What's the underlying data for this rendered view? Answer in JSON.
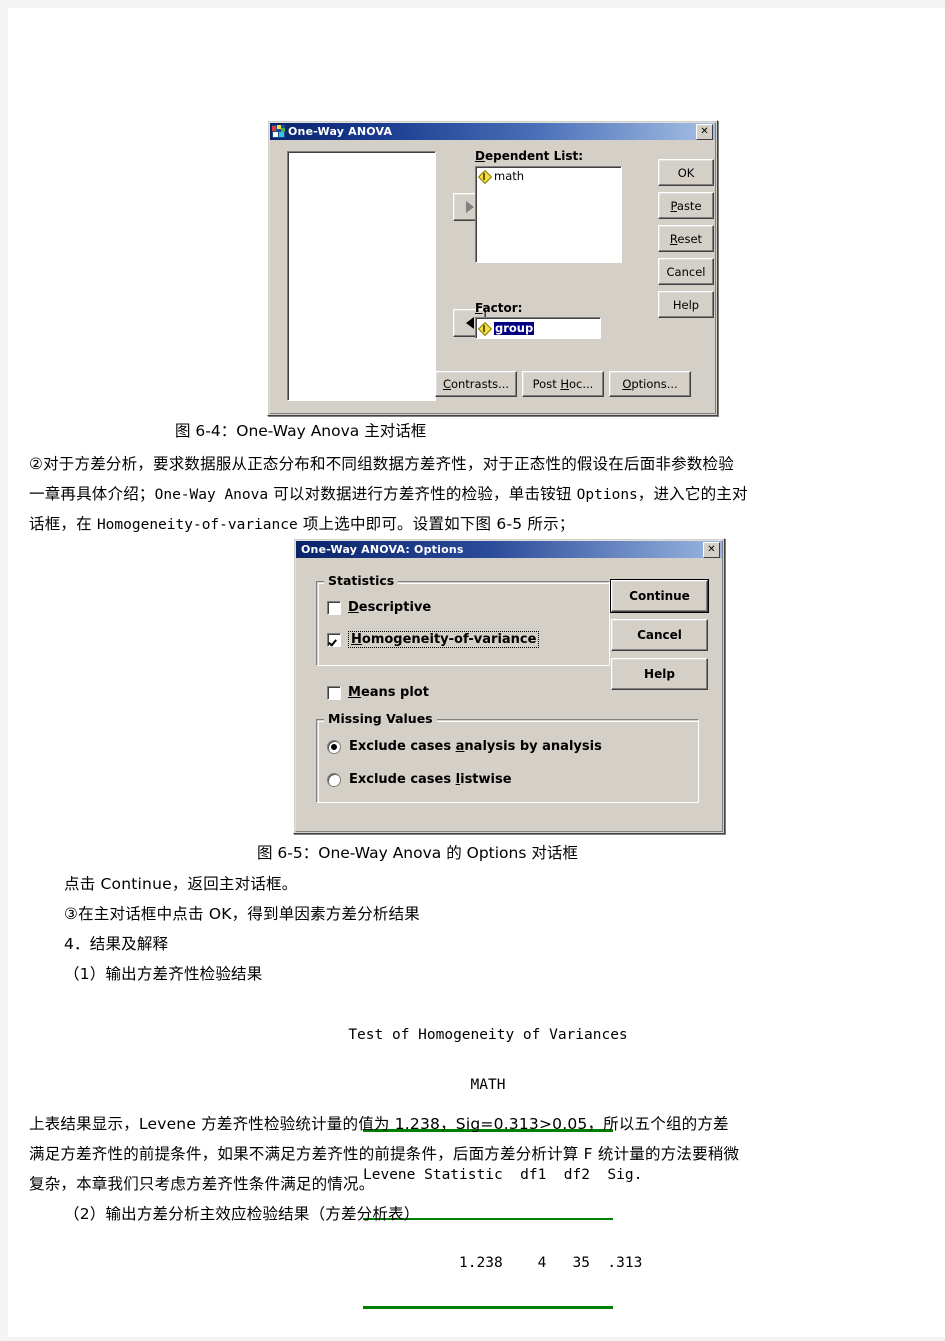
{
  "document": {
    "figure1_caption": "图 6-4：One-Way Anova 主对话框",
    "para1_line1": "②对于方差分析，要求数据服从正态分布和不同组数据方差齐性，对于正态性的假设在后面非参数检验",
    "para1_line2_a": "一章再具体介绍；",
    "para1_line2_b": "One-Way Anova",
    "para1_line2_c": " 可以对数据进行方差齐性的检验，单击铵钮 ",
    "para1_line2_d": "Options",
    "para1_line2_e": "，进入它的主对",
    "para1_line3_a": "话框，在 ",
    "para1_line3_b": "Homogeneity-of-variance",
    "para1_line3_c": " 项上选中即可。设置如下图 6-5 所示；",
    "figure2_caption": "图 6-5：One-Way Anova 的 Options 对话框",
    "para2": "点击 Continue，返回主对话框。",
    "para3": "③在主对话框中点击 OK，得到单因素方差分析结果",
    "para4": "4．结果及解释",
    "para5": "（1）输出方差齐性检验结果",
    "para6_line1": "上表结果显示，Levene 方差齐性检验统计量的值为 1.238，Sig=0.313>0.05，所以五个组的方差",
    "para6_line2": "满足方差齐性的前提条件，如果不满足方差齐性的前提条件，后面方差分析计算 F 统计量的方法要稍微",
    "para6_line3": "复杂，本章我们只考虑方差齐性条件满足的情况。",
    "para7": "（2）输出方差分析主效应检验结果（方差分析表）"
  },
  "anova_dialog": {
    "title": "One-Way ANOVA",
    "close_label": "✕",
    "dependent_label_underline": "D",
    "dependent_label_rest": "ependent List:",
    "dependent_items": [
      "math"
    ],
    "factor_label_underline": "F",
    "factor_label_rest": "actor:",
    "factor_value": "group",
    "move_right_icon": "triangle-right",
    "move_left_icon": "triangle-left",
    "side_buttons": [
      {
        "label": "OK",
        "mnemonic": "",
        "rest": "OK"
      },
      {
        "label": "Paste",
        "mnemonic": "P",
        "rest": "aste"
      },
      {
        "label": "Reset",
        "mnemonic": "R",
        "rest": "eset"
      },
      {
        "label": "Cancel",
        "mnemonic": "",
        "rest": "Cancel"
      },
      {
        "label": "Help",
        "mnemonic": "",
        "rest": "Help"
      }
    ],
    "bottom_buttons": [
      {
        "mnemonic": "C",
        "rest": "ontrasts..."
      },
      {
        "mnemonic": "",
        "rest": "Post H",
        "mnemonic2": "H",
        "tail": "oc..."
      },
      {
        "mnemonic": "O",
        "rest": "ptions..."
      }
    ],
    "bottom_button_plain": [
      "Contrasts...",
      "Post Hoc...",
      "Options..."
    ]
  },
  "options_dialog": {
    "title": "One-Way ANOVA: Options",
    "close_label": "✕",
    "statistics_group": "Statistics",
    "descriptive_mnemonic": "D",
    "descriptive_rest": "escriptive",
    "descriptive_checked": false,
    "homogeneity_mnemonic": "H",
    "homogeneity_rest": "omogeneity-of-variance",
    "homogeneity_checked": true,
    "means_plot_mnemonic": "M",
    "means_plot_rest": "eans plot",
    "means_plot_checked": false,
    "missing_group": "Missing Values",
    "exclude_analysis_pre": "Exclude cases ",
    "exclude_analysis_mnemonic": "a",
    "exclude_analysis_rest": "nalysis by analysis",
    "exclude_analysis_selected": true,
    "exclude_listwise_pre": "Exclude cases ",
    "exclude_listwise_mnemonic": "l",
    "exclude_listwise_rest": "istwise",
    "exclude_listwise_selected": false,
    "buttons": [
      "Continue",
      "Cancel",
      "Help"
    ]
  },
  "levene_table": {
    "title": "Test of Homogeneity of Variances",
    "subtitle": "MATH",
    "headers": [
      "Levene Statistic",
      "df1",
      "df2",
      "Sig."
    ],
    "header_line": "Levene Statistic  df1  df2  Sig.",
    "value_line": "           1.238    4   35  .313",
    "values": [
      "1.238",
      "4",
      "35",
      ".313"
    ],
    "rule_color": "#008000"
  }
}
